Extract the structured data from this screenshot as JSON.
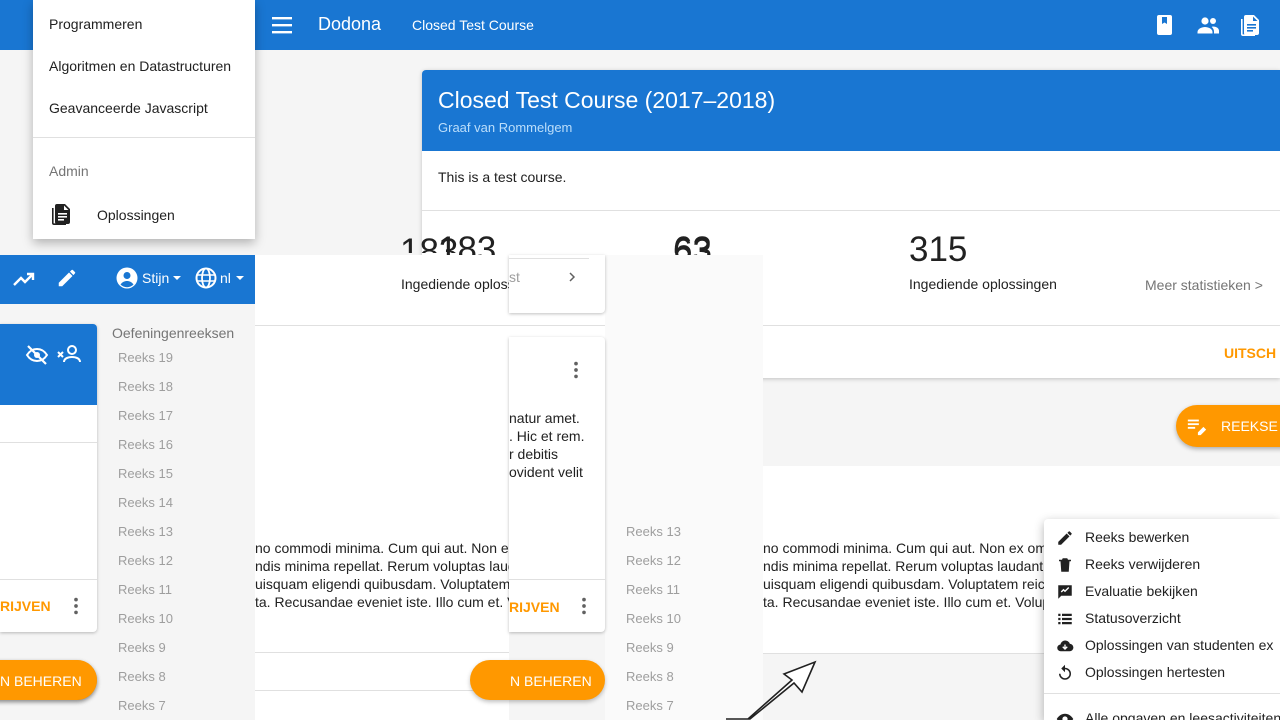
{
  "topbar": {
    "brand": "Dodona",
    "breadcrumb": "Closed Test Course",
    "icons": [
      "book-icon",
      "people-icon",
      "document-icon"
    ],
    "color": "#1976d2"
  },
  "drawer": {
    "items": [
      "Programmeren",
      "Algoritmen en Datastructuren",
      "Geavanceerde Javascript"
    ],
    "admin_header": "Admin",
    "solutions_label": "Oplossingen"
  },
  "course": {
    "title": "Closed Test Course (2017–2018)",
    "teacher": "Graaf van Rommelgem",
    "description": "This is a test course.",
    "stats": [
      {
        "value": "183",
        "label": "Ingediende oplossingen"
      },
      {
        "value": "63",
        "label": ""
      },
      {
        "value": "315",
        "label": "Ingediende oplossingen"
      }
    ],
    "more_stats": "Meer statistieken >",
    "action": "UITSCH"
  },
  "fab": {
    "label": "REEKSE"
  },
  "left_toolbar": {
    "user": "Stijn",
    "language": "nl"
  },
  "small_card": {
    "text": "st"
  },
  "series_sidebar": {
    "header": "Oefeningenreeksen",
    "items": [
      "Reeks 19",
      "Reeks 18",
      "Reeks 17",
      "Reeks 16",
      "Reeks 15",
      "Reeks 14",
      "Reeks 13",
      "Reeks 12",
      "Reeks 11",
      "Reeks 10",
      "Reeks 9",
      "Reeks 8",
      "Reeks 7"
    ]
  },
  "series_sidebar_2": {
    "items": [
      "Reeks 13",
      "Reeks 12",
      "Reeks 11",
      "Reeks 10",
      "Reeks 9",
      "Reeks 8",
      "Reeks 7"
    ]
  },
  "series_text": {
    "mid_lines": [
      "natur amet.",
      ". Hic et rem.",
      "r debitis",
      "ovident velit"
    ],
    "lines": [
      "no commodi minima. Cum qui aut. Non ex",
      "ndis minima repellat. Rerum voluptas laud",
      "uisquam eligendi quibusdam. Voluptatem",
      "ta. Recusandae eveniet iste. Illo cum et. V"
    ],
    "lines_right": [
      "no commodi minima. Cum qui aut. Non ex omm",
      "ndis minima repellat. Rerum voluptas laudanti",
      "uisquam eligendi quibusdam. Voluptatem reici",
      "ta. Recusandae eveniet iste. Illo cum et. Volupt"
    ]
  },
  "buttons": {
    "rijven_1": "RIJVEN",
    "rijven_2": "RIJVEN",
    "beheren_1": "N BEHEREN",
    "beheren_2": "N BEHEREN"
  },
  "context_menu": {
    "items": [
      {
        "icon": "pencil-icon",
        "label": "Reeks bewerken"
      },
      {
        "icon": "trash-icon",
        "label": "Reeks verwijderen"
      },
      {
        "icon": "evaluation-icon",
        "label": "Evaluatie bekijken"
      },
      {
        "icon": "list-icon",
        "label": "Statusoverzicht"
      },
      {
        "icon": "cloud-download-icon",
        "label": "Oplossingen van studenten ex"
      },
      {
        "icon": "replay-icon",
        "label": "Oplossingen hertesten"
      }
    ],
    "last_item": {
      "icon": "eye-icon",
      "label": "Alle opgaven en leesactiviteiten"
    }
  }
}
